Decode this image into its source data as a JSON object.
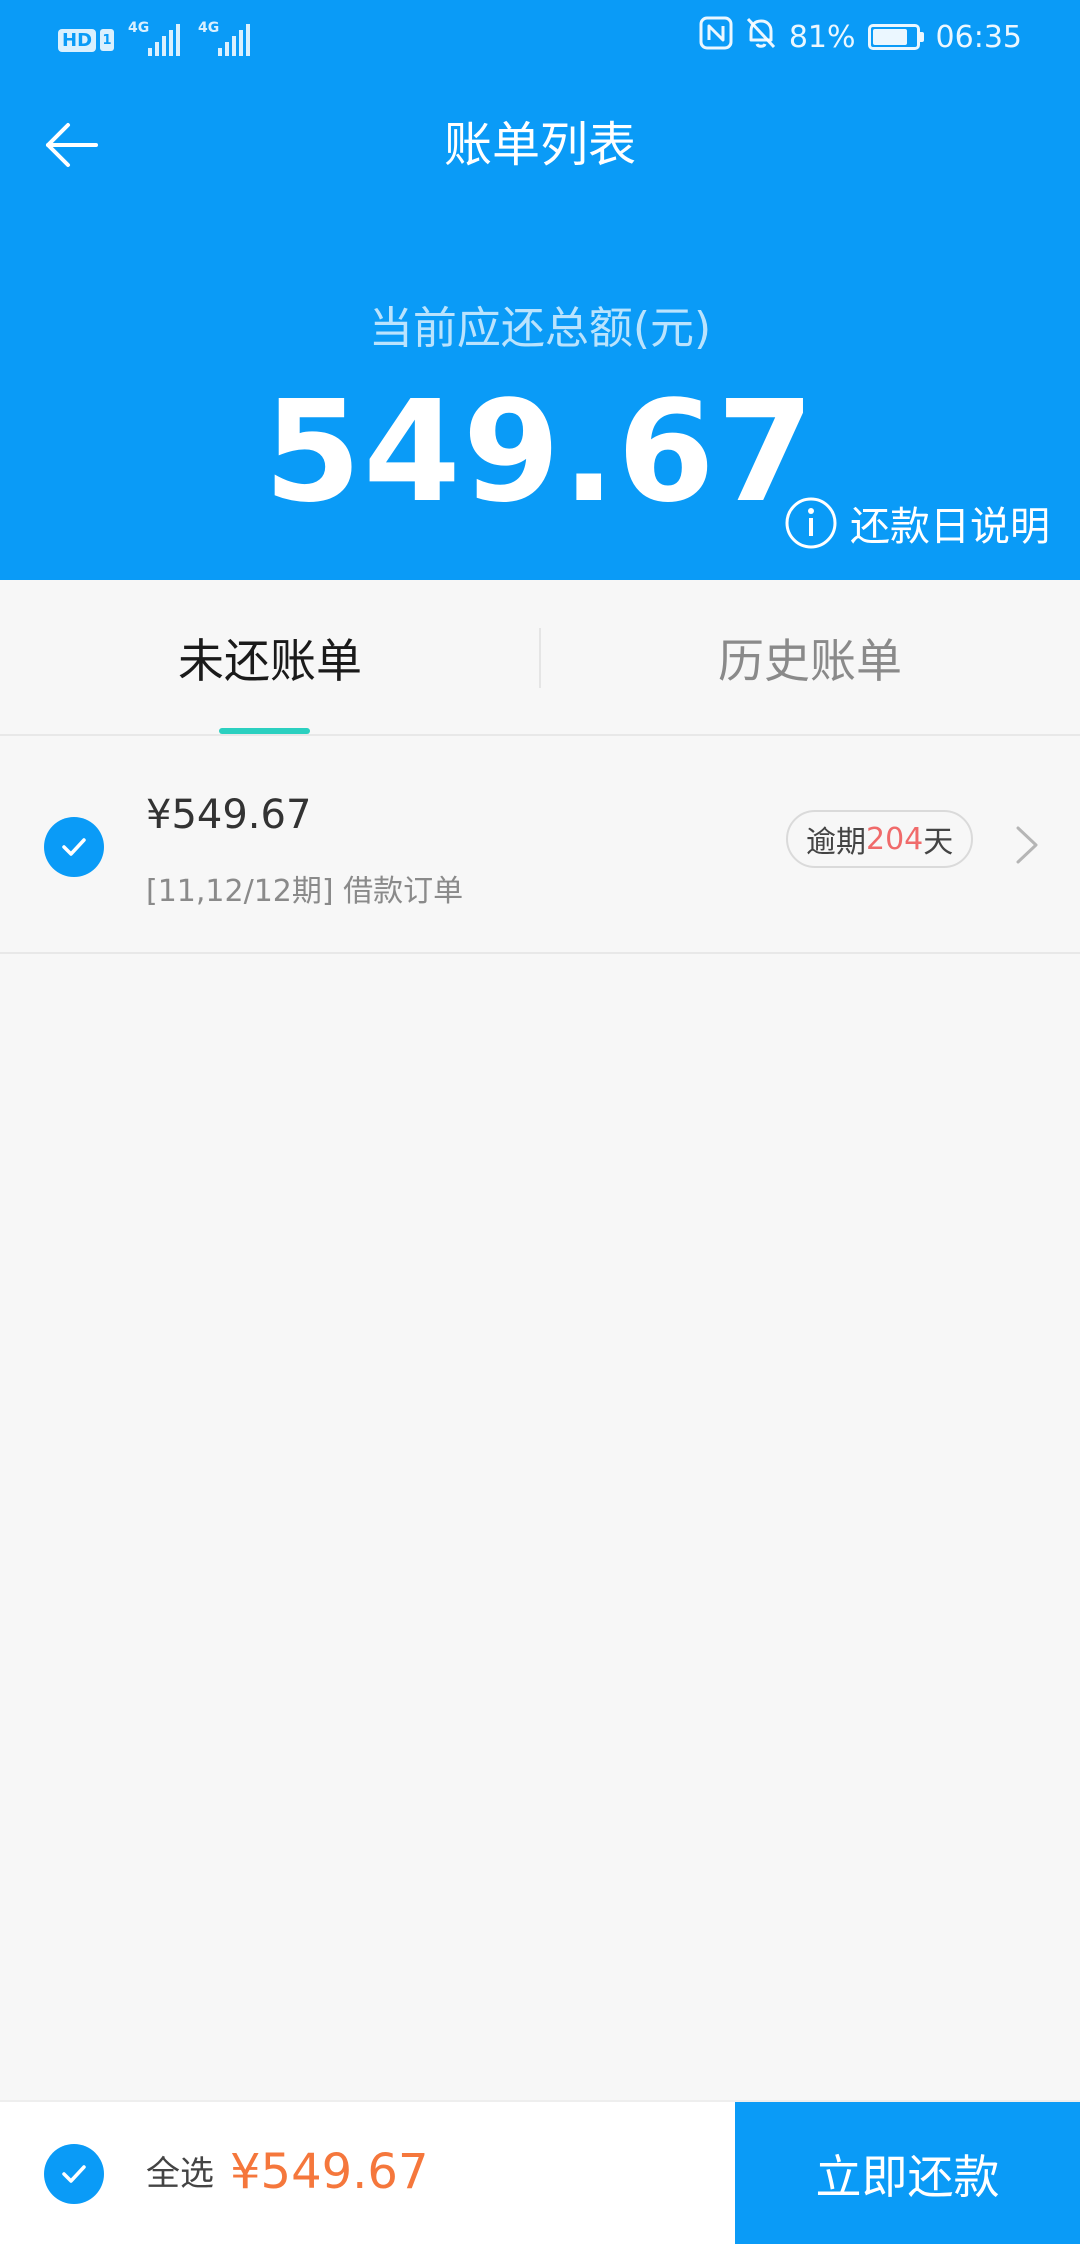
{
  "status_bar": {
    "hd_label": "HD",
    "sim_number": "1",
    "signal1_label": "4G",
    "signal2_label": "4G",
    "battery_percent": "81%",
    "battery_level": 0.81,
    "time": "06:35"
  },
  "header": {
    "title": "账单列表",
    "total_label": "当前应还总额(元)",
    "total_amount": "549.67",
    "due_explain_label": "还款日说明"
  },
  "tabs": [
    {
      "label": "未还账单",
      "active": true
    },
    {
      "label": "历史账单",
      "active": false
    }
  ],
  "bills": [
    {
      "amount": "¥549.67",
      "description": "[11,12/12期] 借款订单",
      "overdue_prefix": "逾期",
      "overdue_days": "204",
      "overdue_suffix": "天",
      "checked": true
    }
  ],
  "bottom_bar": {
    "select_all_label": "全选",
    "total": "¥549.67",
    "pay_label": "立即还款"
  },
  "colors": {
    "primary": "#0a9bf7",
    "tab_indicator": "#2bd0c0",
    "overdue_red": "#f06a6a",
    "price_orange": "#f5773c",
    "background": "#f7f7f7"
  }
}
